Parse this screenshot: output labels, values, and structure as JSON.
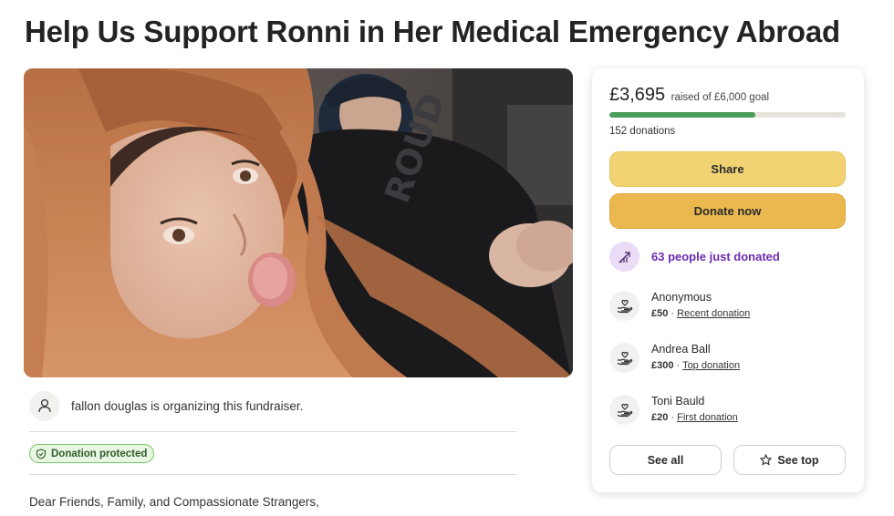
{
  "page": {
    "title": "Help Us Support Ronni in Her Medical Emergency Abroad"
  },
  "organizer": {
    "text": "fallon douglas is organizing this fundraiser."
  },
  "badge": {
    "label": "Donation protected"
  },
  "story": {
    "opening": "Dear Friends, Family, and Compassionate Strangers,"
  },
  "donation_card": {
    "raised": "£3,695",
    "goal_text": "raised of £6,000 goal",
    "progress_fraction": 0.616,
    "donations_count": "152 donations",
    "share_label": "Share",
    "donate_label": "Donate now",
    "recent_activity": "63 people just donated",
    "donors": [
      {
        "name": "Anonymous",
        "amount": "£50",
        "separator": " · ",
        "type": "Recent donation"
      },
      {
        "name": "Andrea Ball",
        "amount": "£300",
        "separator": " · ",
        "type": "Top donation"
      },
      {
        "name": "Toni Bauld",
        "amount": "£20",
        "separator": " · ",
        "type": "First donation"
      }
    ],
    "see_all_label": "See all",
    "see_top_label": "See top"
  },
  "colors": {
    "progress": "#4b9d5c",
    "share_button": "#f1d374",
    "donate_button": "#eab84e",
    "recent_activity": "#6a2bb0",
    "protected_badge": "#e8f6e2"
  },
  "icons": {
    "organizer": "person-icon",
    "badge": "shield-icon",
    "recent": "trending-up-icon",
    "donor": "heart-hand-icon",
    "see_top": "star-icon"
  }
}
